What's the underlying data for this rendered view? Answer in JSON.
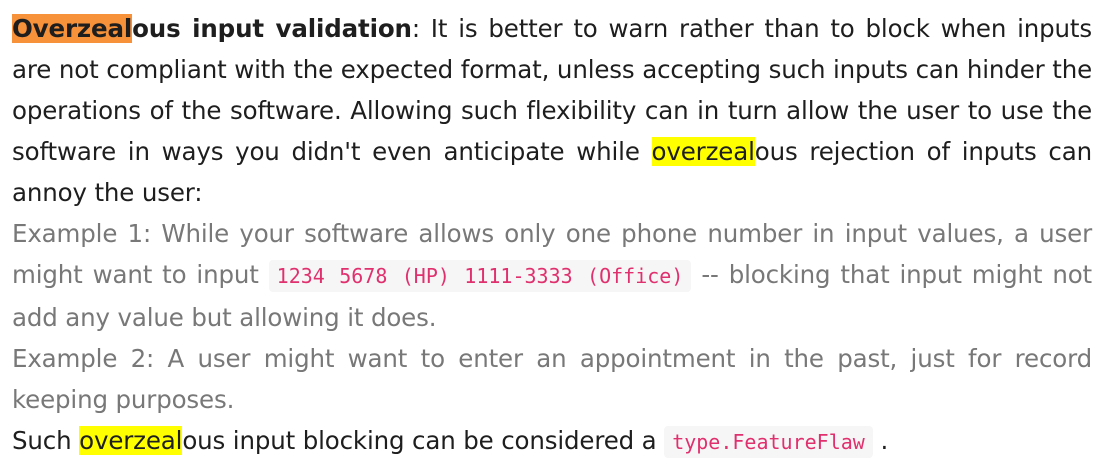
{
  "doc": {
    "p1": {
      "hl": "Overzeal",
      "term_rest": "ous input validation",
      "t1": ": It is better to warn rather than to block when inputs are not compliant with the expected format, unless accepting such inputs can hinder the operations of the software. Allowing such flexibility can in turn allow the user to use the software in ways you didn't even anticipate while ",
      "hl2": "overzeal",
      "t2": "ous rejection of inputs can annoy the user:"
    },
    "ex1": {
      "t1": "Example 1: While your software allows only one phone number in input values, a user might want to input ",
      "code": "1234 5678 (HP) 1111-3333 (Office)",
      "t2": " -- blocking that input might not add any value but allowing it does."
    },
    "ex2": {
      "text": "Example 2: A user might want to enter an appointment in the past, just for record keeping purposes."
    },
    "p4": {
      "t1": "Such ",
      "hl": "overzeal",
      "t2": "ous input blocking can be considered a ",
      "code": "type.FeatureFlaw",
      "t3": " ."
    }
  },
  "colors": {
    "text": "#1e1e1e",
    "muted": "#787878",
    "highlight_orange": "#f7923a",
    "highlight_yellow": "#ffff00",
    "code_text": "#e0306e",
    "code_bg": "#f6f6f6"
  }
}
